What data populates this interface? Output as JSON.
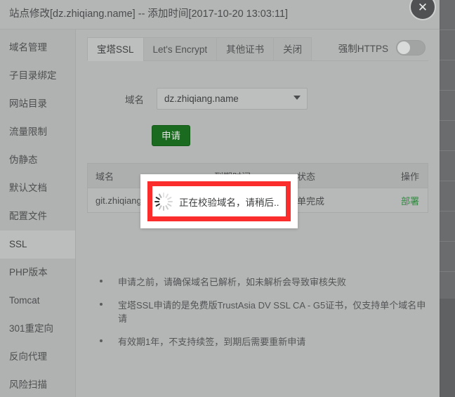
{
  "window": {
    "title": "站点修改[dz.zhiqiang.name] -- 添加时间[2017-10-20 13:03:11]",
    "close_icon": "close-icon"
  },
  "sidebar": {
    "items": [
      {
        "label": "域名管理",
        "active": false
      },
      {
        "label": "子目录绑定",
        "active": false
      },
      {
        "label": "网站目录",
        "active": false
      },
      {
        "label": "流量限制",
        "active": false
      },
      {
        "label": "伪静态",
        "active": false
      },
      {
        "label": "默认文档",
        "active": false
      },
      {
        "label": "配置文件",
        "active": false
      },
      {
        "label": "SSL",
        "active": true
      },
      {
        "label": "PHP版本",
        "active": false
      },
      {
        "label": "Tomcat",
        "active": false
      },
      {
        "label": "301重定向",
        "active": false
      },
      {
        "label": "反向代理",
        "active": false
      },
      {
        "label": "风险扫描",
        "active": false
      }
    ]
  },
  "tabs": [
    {
      "label": "宝塔SSL",
      "active": true
    },
    {
      "label": "Let's Encrypt",
      "active": false
    },
    {
      "label": "其他证书",
      "active": false
    },
    {
      "label": "关闭",
      "active": false
    }
  ],
  "https_toggle": {
    "label": "强制HTTPS",
    "state": "off"
  },
  "form": {
    "domain_label": "域名",
    "domain_value": "dz.zhiqiang.name",
    "caret_icon": "chevron-down-icon",
    "apply_label": "申请"
  },
  "table": {
    "headers": [
      "域名",
      "到期时间",
      "状态",
      "操作"
    ],
    "rows": [
      {
        "domain": "git.zhiqiang.",
        "expire": "",
        "status": "单完成",
        "action": "部署"
      }
    ]
  },
  "hints": [
    "申请之前，请确保域名已解析，如未解析会导致审核失败",
    "宝塔SSL申请的是免费版TrustAsia DV SSL CA - G5证书，仅支持单个域名申请",
    "有效期1年，不支持续签，到期后需要重新申请"
  ],
  "toast": {
    "message": "正在校验域名，请稍后..",
    "spinner_icon": "loading-spinner-icon"
  },
  "colors": {
    "apply_button": "#1a6b1f",
    "deploy_link": "#2f8a3f",
    "annotation": "#fb2c2c",
    "panel": "#b4b5b5"
  }
}
